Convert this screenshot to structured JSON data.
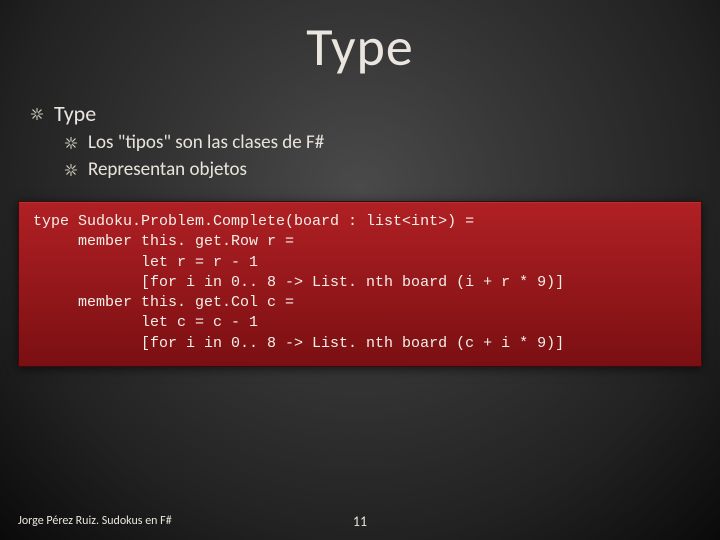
{
  "title": "Type",
  "bullets": {
    "level1": "Type",
    "sub1": "Los \"tipos\" son las clases de F#",
    "sub2": "Representan objetos"
  },
  "code": {
    "l0": "type Sudoku.Problem.Complete(board : list<int>) =",
    "l1": "",
    "l2": "     member this. get.Row r =",
    "l3": "            let r = r - 1",
    "l4": "            [for i in 0.. 8 -> List. nth board (i + r * 9)]",
    "l5": "",
    "l6": "     member this. get.Col c =",
    "l7": "            let c = c - 1",
    "l8": "            [for i in 0.. 8 -> List. nth board (c + i * 9)]"
  },
  "footer": {
    "author": "Jorge Pérez Ruiz. Sudokus en F#",
    "page": "11"
  }
}
